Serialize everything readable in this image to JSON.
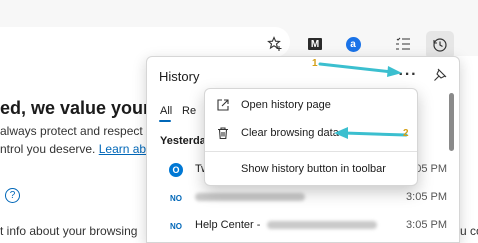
{
  "toolbar": {
    "icons": [
      "favorites-star-icon",
      "gmail-icon",
      "extension-icon",
      "collections-icon",
      "history-icon"
    ],
    "gmail_glyph": "M",
    "extension_glyph": "a"
  },
  "page": {
    "heading": "ed, we value your",
    "line1": "always protect and respect",
    "line2_prefix": "ntrol you deserve.",
    "line2_link": "Learn abo",
    "help_glyph": "?",
    "line3": "t info about your browsing",
    "line4": "u co"
  },
  "history": {
    "title": "History",
    "more_glyph": "···",
    "pin_glyph": "⚲",
    "tabs": [
      {
        "label": "All",
        "active": true
      },
      {
        "label": "Re"
      }
    ],
    "section": "Yesterday",
    "rows": [
      {
        "icon": "O",
        "title": "Tw",
        "time": "3:05 PM"
      },
      {
        "icon": "NO",
        "title": "",
        "time": "3:05 PM"
      },
      {
        "icon": "NO",
        "title": "Help Center -",
        "time": "3:05 PM"
      }
    ]
  },
  "menu": {
    "items": [
      {
        "label": "Open history page",
        "icon": "open-external-icon"
      },
      {
        "label": "Clear browsing data",
        "icon": "trash-icon"
      },
      {
        "label": "Show history button in toolbar",
        "icon": ""
      }
    ]
  },
  "annotations": {
    "step1": "1",
    "step2": "2",
    "arrow_color": "#3bbfcf"
  },
  "colors": {
    "accent": "#0067b8",
    "toolbar_bg": "#f7f7f7"
  }
}
